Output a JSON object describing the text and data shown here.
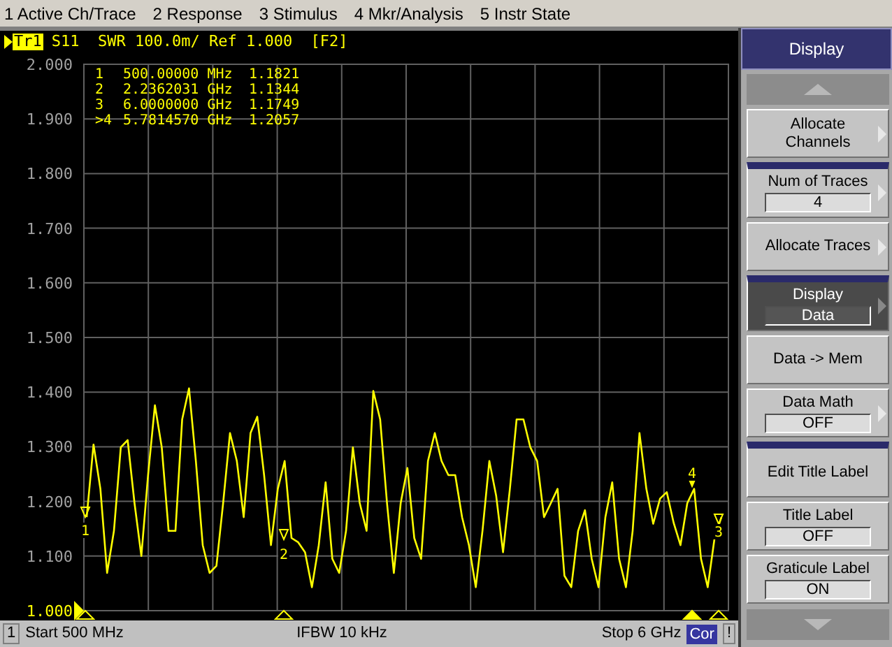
{
  "menu_bar": [
    {
      "label": "1 Active Ch/Trace"
    },
    {
      "label": "2 Response"
    },
    {
      "label": "3 Stimulus"
    },
    {
      "label": "4 Mkr/Analysis"
    },
    {
      "label": "5 Instr State"
    }
  ],
  "trace_header": {
    "badge": "Tr1",
    "text": "S11  SWR 100.0m/ Ref 1.000  [F2]"
  },
  "marker_readouts": [
    {
      "number": "1",
      "stimulus": "500.00000 MHz",
      "value": "1.1821"
    },
    {
      "number": "2",
      "stimulus": "2.2362031 GHz",
      "value": "1.1344"
    },
    {
      "number": "3",
      "stimulus": "6.0000000 GHz",
      "value": "1.1749"
    },
    {
      "number": ">4",
      "stimulus": "5.7814570 GHz",
      "value": "1.2057"
    }
  ],
  "chart_data": {
    "type": "line",
    "ylim": [
      1.0,
      2.0
    ],
    "grid": true,
    "yticks": [
      {
        "value": 2.0,
        "label": "2.000"
      },
      {
        "value": 1.9,
        "label": "1.900"
      },
      {
        "value": 1.8,
        "label": "1.800"
      },
      {
        "value": 1.7,
        "label": "1.700"
      },
      {
        "value": 1.6,
        "label": "1.600"
      },
      {
        "value": 1.5,
        "label": "1.500"
      },
      {
        "value": 1.4,
        "label": "1.400"
      },
      {
        "value": 1.3,
        "label": "1.300"
      },
      {
        "value": 1.2,
        "label": "1.200"
      },
      {
        "value": 1.1,
        "label": "1.100"
      },
      {
        "value": 1.0,
        "label": "1.000"
      }
    ],
    "series": [
      {
        "color": "#ffff00",
        "values": [
          1.171,
          1.304,
          1.223,
          1.069,
          1.146,
          1.299,
          1.312,
          1.197,
          1.1,
          1.248,
          1.376,
          1.299,
          1.146,
          1.146,
          1.35,
          1.407,
          1.274,
          1.12,
          1.069,
          1.082,
          1.197,
          1.325,
          1.274,
          1.171,
          1.325,
          1.355,
          1.248,
          1.12,
          1.223,
          1.274,
          1.133,
          1.125,
          1.107,
          1.043,
          1.12,
          1.235,
          1.095,
          1.069,
          1.146,
          1.299,
          1.197,
          1.146,
          1.402,
          1.35,
          1.197,
          1.069,
          1.197,
          1.261,
          1.133,
          1.095,
          1.274,
          1.325,
          1.274,
          1.248,
          1.248,
          1.171,
          1.12,
          1.043,
          1.146,
          1.274,
          1.21,
          1.107,
          1.223,
          1.35,
          1.35,
          1.299,
          1.274,
          1.171,
          1.197,
          1.223,
          1.064,
          1.043,
          1.146,
          1.184,
          1.095,
          1.043,
          1.171,
          1.235,
          1.095,
          1.043,
          1.146,
          1.325,
          1.223,
          1.159,
          1.205,
          1.217,
          1.161,
          1.12,
          1.197,
          1.223,
          1.095,
          1.043,
          1.133,
          1.171
        ]
      }
    ]
  },
  "trace_markers": [
    {
      "label": "1",
      "selected": false
    },
    {
      "label": "2",
      "selected": false
    },
    {
      "label": "3",
      "selected": false
    },
    {
      "label": "4",
      "selected": true
    }
  ],
  "status_bar": {
    "channel": "1",
    "start": "Start 500 MHz",
    "ifbw": "IFBW 10 kHz",
    "stop": "Stop 6 GHz",
    "correction": "Cor",
    "alert": "!"
  },
  "softkey_panel": {
    "title": "Display",
    "keys": [
      {
        "label": "Allocate Channels",
        "submenu": true,
        "selected": false,
        "separator_before": false
      },
      {
        "label": "Num of Traces",
        "value": "4",
        "submenu": true,
        "selected": false,
        "separator_before": true
      },
      {
        "label": "Allocate Traces",
        "submenu": true,
        "selected": false,
        "separator_before": false
      },
      {
        "label": "Display",
        "value": "Data",
        "submenu": true,
        "selected": true,
        "separator_before": true
      },
      {
        "label": "Data -> Mem",
        "submenu": false,
        "selected": false,
        "separator_before": false
      },
      {
        "label": "Data Math",
        "value": "OFF",
        "submenu": true,
        "selected": false,
        "separator_before": false
      },
      {
        "label": "Edit Title Label",
        "submenu": false,
        "selected": false,
        "separator_before": true
      },
      {
        "label": "Title Label",
        "value": "OFF",
        "submenu": false,
        "selected": false,
        "separator_before": false
      },
      {
        "label": "Graticule Label",
        "value": "ON",
        "submenu": false,
        "selected": false,
        "separator_before": false
      }
    ]
  }
}
